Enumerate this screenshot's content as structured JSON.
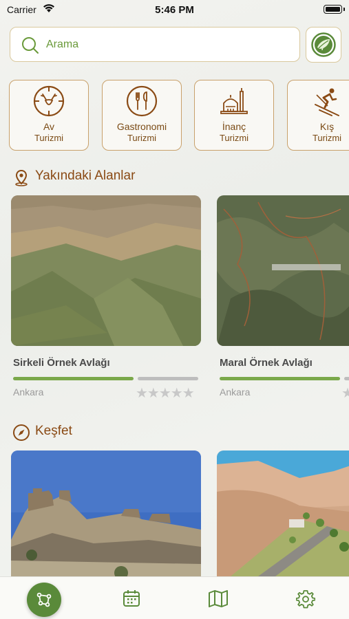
{
  "status_bar": {
    "carrier": "Carrier",
    "time": "5:46 PM"
  },
  "search": {
    "placeholder": "Arama",
    "value": ""
  },
  "categories": [
    {
      "name": "Av",
      "sub": "Turizmi",
      "icon": "deer-icon"
    },
    {
      "name": "Gastronomi",
      "sub": "Turizmi",
      "icon": "cutlery-icon"
    },
    {
      "name": "İnanç",
      "sub": "Turizmi",
      "icon": "mosque-icon"
    },
    {
      "name": "Kış",
      "sub": "Turizmi",
      "icon": "skier-icon"
    }
  ],
  "nearby": {
    "title": "Yakındaki Alanlar",
    "items": [
      {
        "name": "Sirkeli Örnek Avlağı",
        "city": "Ankara",
        "stars": "★★★★★",
        "rating": 0
      },
      {
        "name": "Maral Örnek Avlağı",
        "city": "Ankara",
        "stars": "★★★★★",
        "rating": 0
      }
    ]
  },
  "discover": {
    "title": "Keşfet"
  },
  "tab_bar": {
    "tabs": [
      "route-icon",
      "calendar-icon",
      "map-icon",
      "settings-icon"
    ],
    "active": 0
  },
  "colors": {
    "accent_green": "#5a8a3a",
    "brown": "#8a4a14",
    "card_border": "#c8a06a"
  }
}
